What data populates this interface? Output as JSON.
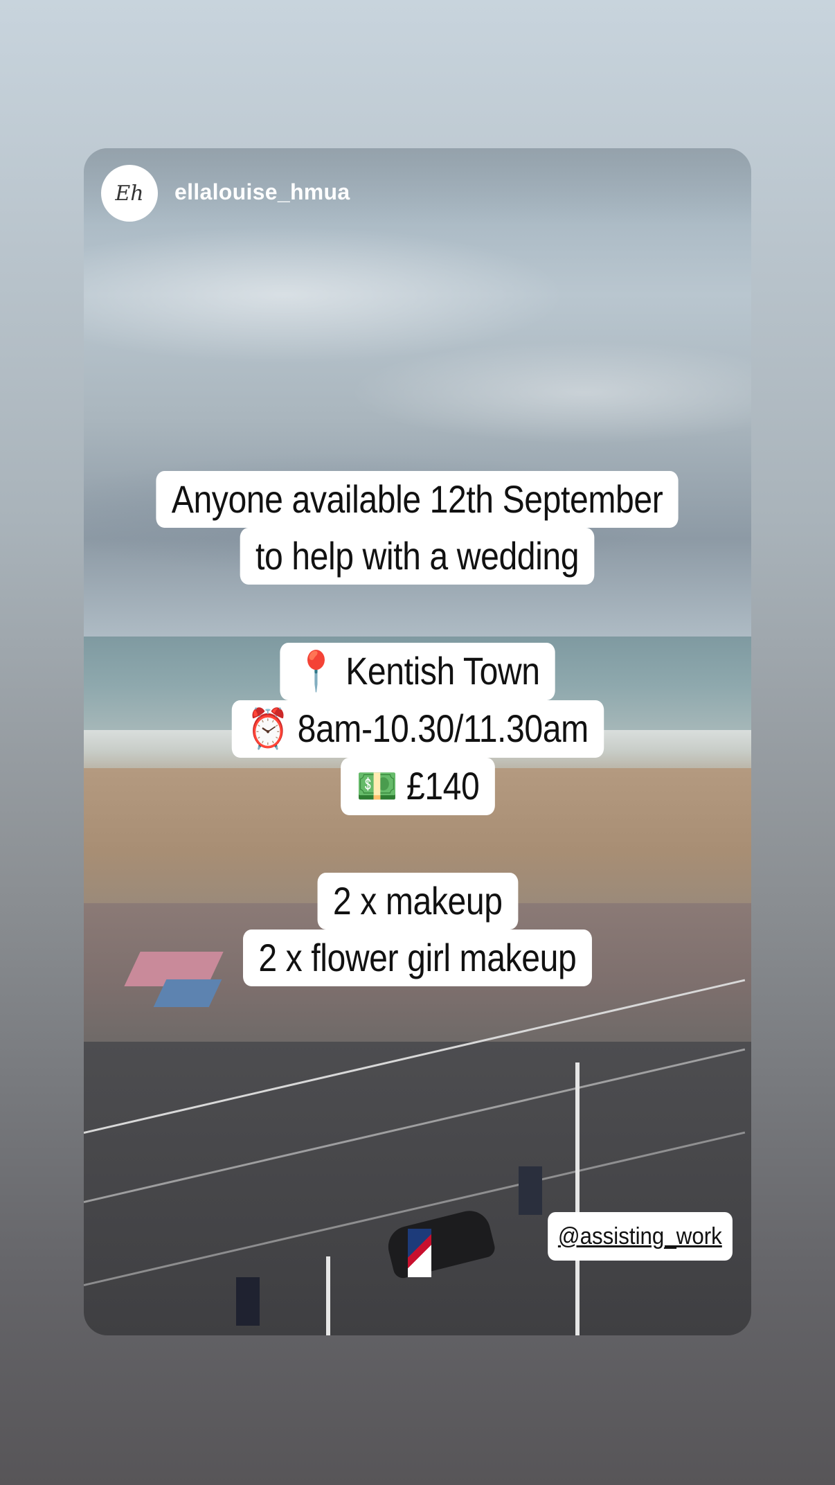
{
  "story": {
    "username": "ellalouise_hmua",
    "avatar_initials": "Eh"
  },
  "captions": {
    "headline": [
      "Anyone available 12th September",
      "to help with a wedding"
    ],
    "details": [
      {
        "emoji": "📍",
        "text": "Kentish Town"
      },
      {
        "emoji": "⏰",
        "text": "8am-10.30/11.30am"
      },
      {
        "emoji": "💵",
        "text": "£140"
      }
    ],
    "roles": [
      "2 x makeup",
      "2 x flower girl makeup"
    ]
  },
  "mention_tag": "@assisting_work",
  "colors": {
    "caption_bg": "#ffffff",
    "caption_text": "#111111",
    "username_text": "#ffffff"
  }
}
